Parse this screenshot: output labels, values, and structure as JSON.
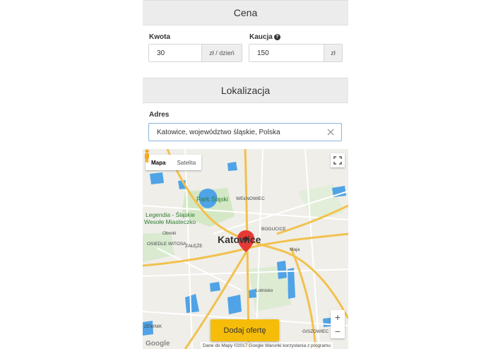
{
  "price_section": {
    "title": "Cena",
    "amount_label": "Kwota",
    "amount_value": "30",
    "amount_unit": "zł / dzień",
    "deposit_label": "Kaucja",
    "deposit_help_icon": "question-circle-icon",
    "deposit_value": "150",
    "deposit_unit": "zł"
  },
  "location_section": {
    "title": "Lokalizacja",
    "address_label": "Adres",
    "address_value": "Katowice, województwo śląskie, Polska",
    "clear_icon": "close-icon"
  },
  "map": {
    "type_buttons": [
      "Mapa",
      "Satelita"
    ],
    "labels": {
      "city": "Katowice",
      "park": "Park Śląski",
      "legendia": "Legendia - Śląskie",
      "legendia2": "Wesołe Miasteczko",
      "welnowiec": "WEŁNOWIEC",
      "bogucice": "BOGUCICE",
      "osiedle": "OSIEDLE WITOSA",
      "zaleze": "ZAŁĘŻE",
      "obroki": "Obroki",
      "majowa": "Maja",
      "lotnisko": "Lotnisko",
      "giszowiec": "GISZOWIEC",
      "zenwik": "ZEWNIK"
    },
    "zoom_in": "+",
    "zoom_out": "−",
    "google_logo": "Google",
    "attribution": "Dane do Mapy ©2017 Google   Warunki korzystania z programu"
  },
  "submit": {
    "label": "Dodaj ofertę"
  },
  "colors": {
    "header_bg": "#ececec",
    "cta": "#f5bd0a",
    "marker": "#e53935",
    "water": "#4fa3e6",
    "road_major": "#f2c14e"
  }
}
